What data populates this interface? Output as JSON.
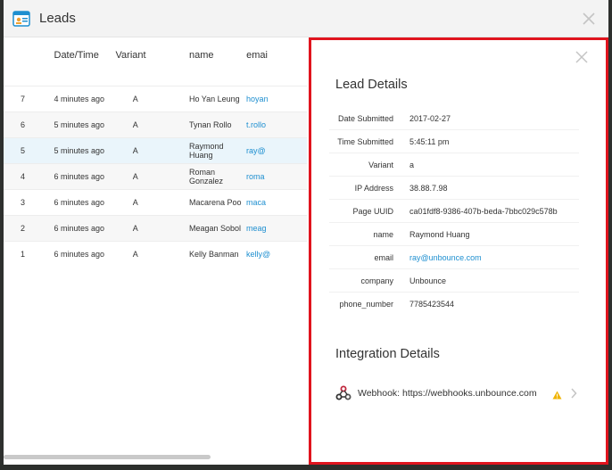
{
  "modal": {
    "title": "Leads",
    "close_icon": "close-icon"
  },
  "table": {
    "columns": {
      "id": "",
      "date": "Date/Time",
      "variant": "Variant",
      "name": "name",
      "email": "emai"
    },
    "rows": [
      {
        "id": "7",
        "date": "4 minutes ago",
        "variant": "A",
        "name": "Ho Yan Leung",
        "email": "hoyan"
      },
      {
        "id": "6",
        "date": "5 minutes ago",
        "variant": "A",
        "name": "Tynan Rollo",
        "email": "t.rollo"
      },
      {
        "id": "5",
        "date": "5 minutes ago",
        "variant": "A",
        "name": "Raymond Huang",
        "email": "ray@"
      },
      {
        "id": "4",
        "date": "6 minutes ago",
        "variant": "A",
        "name": "Roman Gonzalez",
        "email": "roma"
      },
      {
        "id": "3",
        "date": "6 minutes ago",
        "variant": "A",
        "name": "Macarena Poo",
        "email": "maca"
      },
      {
        "id": "2",
        "date": "6 minutes ago",
        "variant": "A",
        "name": "Meagan Sobol",
        "email": "meag"
      },
      {
        "id": "1",
        "date": "6 minutes ago",
        "variant": "A",
        "name": "Kelly Banman",
        "email": "kelly@"
      }
    ],
    "selected_row": "5"
  },
  "details": {
    "title": "Lead Details",
    "fields": [
      {
        "key": "Date Submitted",
        "value": "2017-02-27"
      },
      {
        "key": "Time Submitted",
        "value": "5:45:11 pm"
      },
      {
        "key": "Variant",
        "value": "a"
      },
      {
        "key": "IP Address",
        "value": "38.88.7.98"
      },
      {
        "key": "Page UUID",
        "value": "ca01fdf8-9386-407b-beda-7bbc029c578b"
      },
      {
        "key": "name",
        "value": "Raymond Huang"
      },
      {
        "key": "email",
        "value": "ray@unbounce.com"
      },
      {
        "key": "company",
        "value": "Unbounce"
      },
      {
        "key": "phone_number",
        "value": "7785423544"
      }
    ]
  },
  "integration": {
    "title": "Integration Details",
    "webhook_label": "Webhook: https://webhooks.unbounce.com",
    "status_icon": "warning-icon"
  },
  "colors": {
    "highlight_border": "#e0141e",
    "link": "#1e8fd0",
    "selected_row": "#eaf5fb",
    "warning": "#f0b400"
  }
}
